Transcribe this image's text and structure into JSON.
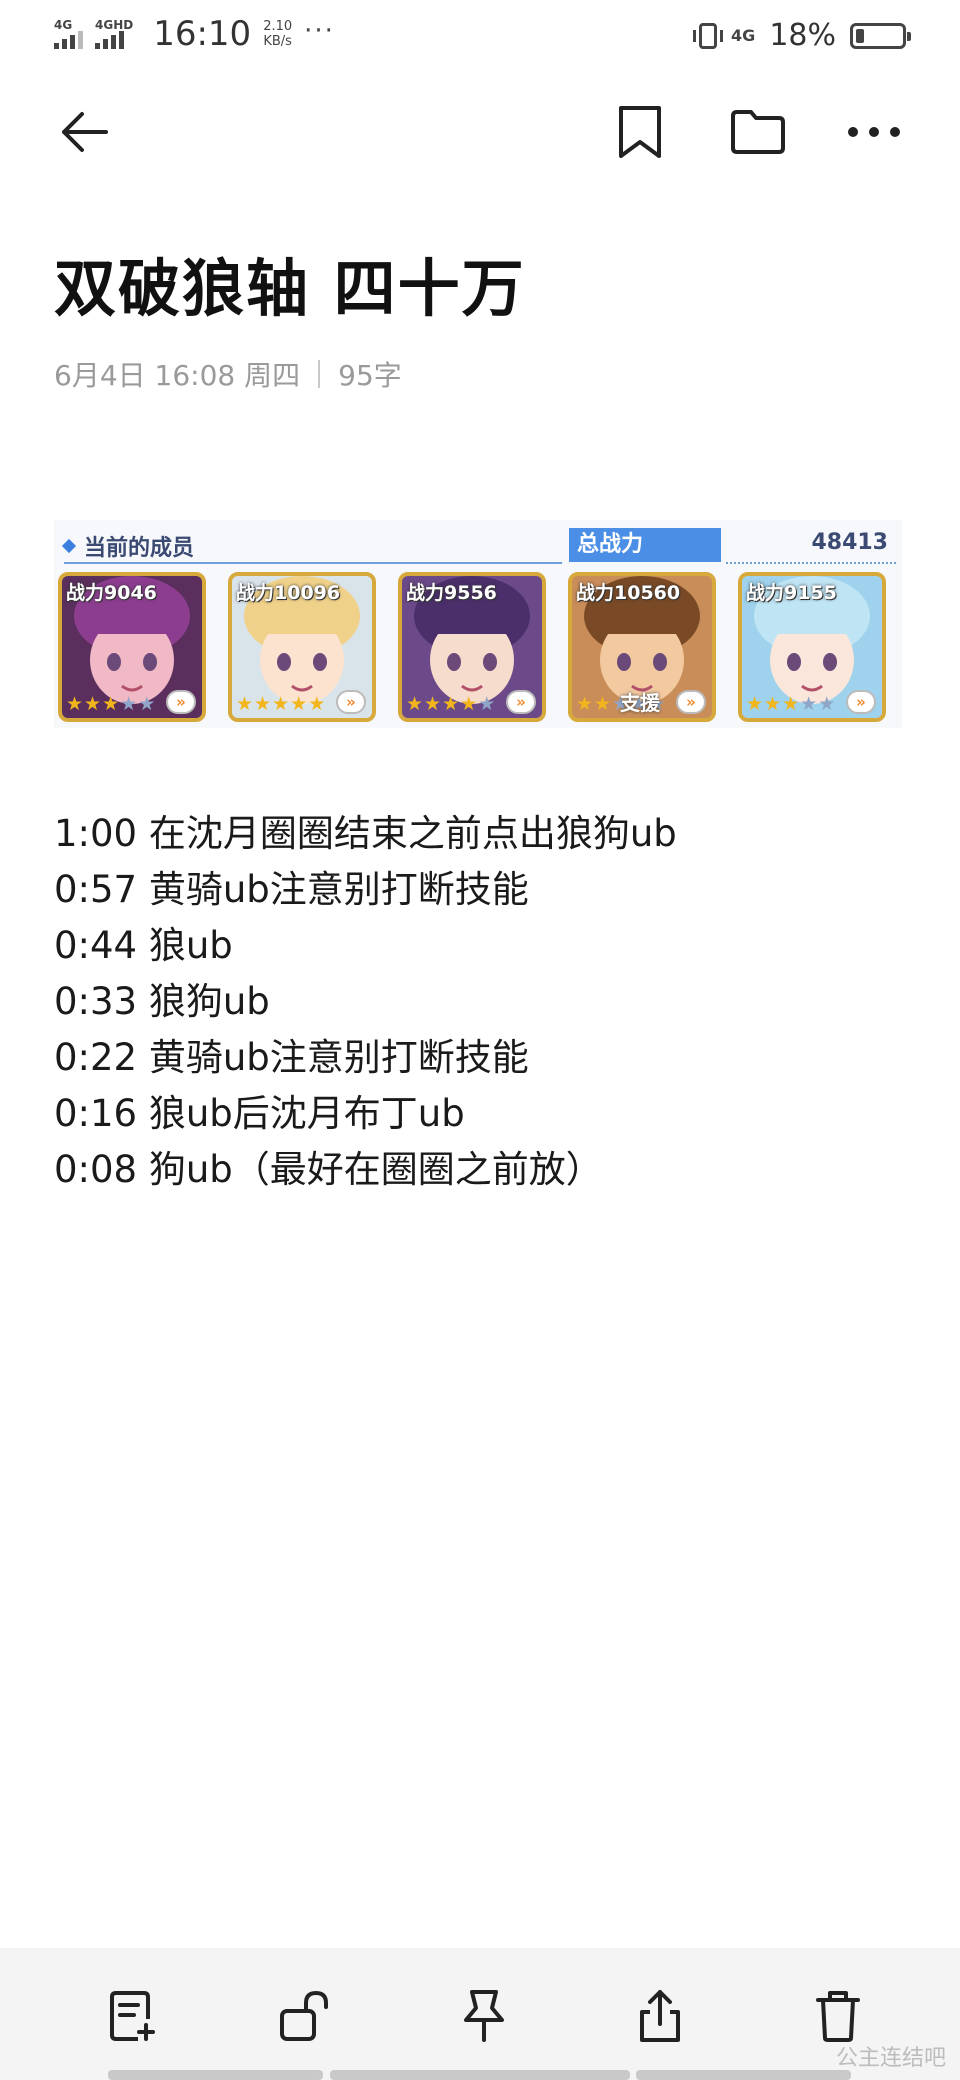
{
  "status_bar": {
    "signal1_label": "4G",
    "signal2_label": "4GHD",
    "time": "16:10",
    "net_speed_value": "2.10",
    "net_speed_unit": "KB/s",
    "more_dots": "···",
    "net_type": "4G",
    "battery_percent": "18%",
    "battery_level": 0.18
  },
  "toolbar": {
    "back_icon": "arrow-left-icon",
    "bookmark_icon": "bookmark-icon",
    "folder_icon": "folder-icon",
    "more_icon": "more-horizontal-icon"
  },
  "note": {
    "title": "双破狼轴 四十万",
    "date": "6月4日 16:08 周四",
    "word_count": "95字",
    "lines": [
      "1:00 在沈月圈圈结束之前点出狼狗ub",
      "0:57 黄骑ub注意别打断技能",
      "0:44 狼ub",
      "0:33 狼狗ub",
      "0:22 黄骑ub注意别打断技能",
      "0:16 狼ub后沈月布丁ub",
      "0:08 狗ub（最好在圈圈之前放）"
    ]
  },
  "team_image": {
    "members_label": "当前的成员",
    "total_power_label": "总战力",
    "total_power_value": "48413",
    "cards": [
      {
        "power": "战力9046",
        "stars": 5,
        "filled": 3,
        "bg": "#5a2f5e",
        "face": "#f1b8c6",
        "hair": "#8c3d8f"
      },
      {
        "power": "战力10096",
        "stars": 5,
        "filled": 5,
        "bg": "#d9e4ea",
        "face": "#fbe3cf",
        "hair": "#f0d18a"
      },
      {
        "power": "战力9556",
        "stars": 5,
        "filled": 4,
        "bg": "#6c4a8a",
        "face": "#f6dccd",
        "hair": "#4a2f6a"
      },
      {
        "power": "战力10560",
        "stars": 5,
        "filled": 2,
        "bg": "#c98d5a",
        "face": "#f3c9a0",
        "hair": "#7a4a26",
        "support": "支援"
      },
      {
        "power": "战力9155",
        "stars": 5,
        "filled": 3,
        "bg": "#9fd2ec",
        "face": "#fbe6dc",
        "hair": "#bfe5f5"
      }
    ]
  },
  "bottom_bar": {
    "icons": [
      "note-add-icon",
      "unlock-icon",
      "pin-icon",
      "share-icon",
      "trash-icon"
    ]
  },
  "watermark": "公主连结吧",
  "colors": {
    "accent": "#4b8ee6",
    "card_border": "#d7a93a",
    "star": "#f2b51c"
  }
}
